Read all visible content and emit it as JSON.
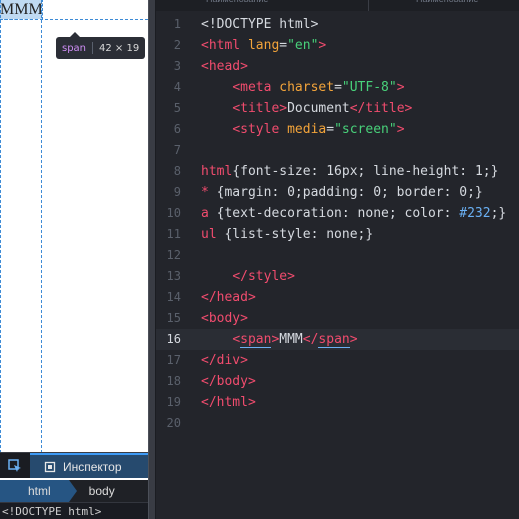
{
  "browser": {
    "rendered_text": "MMM",
    "tooltip": {
      "tag": "span",
      "dimensions": "42 × 19"
    }
  },
  "devtools": {
    "inspector_tab_label": "Инспектор",
    "breadcrumbs": [
      "html",
      "body"
    ],
    "markup_preview": "<!DOCTYPE html>"
  },
  "editor": {
    "tabs": [
      "Наименование",
      "Наименование"
    ],
    "active_line": 16,
    "lines": [
      {
        "n": "1",
        "tokens": [
          {
            "t": "<!DOCTYPE html>",
            "c": "text"
          }
        ]
      },
      {
        "n": "2",
        "tokens": [
          {
            "t": "<html",
            "c": "tag"
          },
          {
            "t": " lang",
            "c": "attr"
          },
          {
            "t": "=",
            "c": "punct"
          },
          {
            "t": "\"en\"",
            "c": "str"
          },
          {
            "t": ">",
            "c": "tag"
          }
        ]
      },
      {
        "n": "3",
        "tokens": [
          {
            "t": "<head>",
            "c": "tag"
          }
        ]
      },
      {
        "n": "4",
        "tokens": [
          {
            "t": "    ",
            "c": "text"
          },
          {
            "t": "<meta",
            "c": "tag"
          },
          {
            "t": " charset",
            "c": "attr"
          },
          {
            "t": "=",
            "c": "punct"
          },
          {
            "t": "\"UTF-8\"",
            "c": "str"
          },
          {
            "t": ">",
            "c": "tag"
          }
        ]
      },
      {
        "n": "5",
        "tokens": [
          {
            "t": "    ",
            "c": "text"
          },
          {
            "t": "<title>",
            "c": "tag"
          },
          {
            "t": "Document",
            "c": "text"
          },
          {
            "t": "</title>",
            "c": "tag"
          }
        ]
      },
      {
        "n": "6",
        "tokens": [
          {
            "t": "    ",
            "c": "text"
          },
          {
            "t": "<style",
            "c": "tag"
          },
          {
            "t": " media",
            "c": "attr"
          },
          {
            "t": "=",
            "c": "punct"
          },
          {
            "t": "\"screen\"",
            "c": "str"
          },
          {
            "t": ">",
            "c": "tag"
          }
        ]
      },
      {
        "n": "7",
        "tokens": []
      },
      {
        "n": "8",
        "tokens": [
          {
            "t": "html",
            "c": "sel"
          },
          {
            "t": "{font-size: 16px; line-height: 1;}",
            "c": "prop"
          }
        ]
      },
      {
        "n": "9",
        "tokens": [
          {
            "t": "*",
            "c": "sel"
          },
          {
            "t": " {margin: 0;padding: 0; border: 0;}",
            "c": "prop"
          }
        ]
      },
      {
        "n": "10",
        "tokens": [
          {
            "t": "a",
            "c": "sel"
          },
          {
            "t": " {text-decoration: none; color: ",
            "c": "prop"
          },
          {
            "t": "#232",
            "c": "hex"
          },
          {
            "t": ";}",
            "c": "prop"
          }
        ]
      },
      {
        "n": "11",
        "tokens": [
          {
            "t": "ul",
            "c": "sel"
          },
          {
            "t": " {list-style: none;}",
            "c": "prop"
          }
        ]
      },
      {
        "n": "12",
        "tokens": []
      },
      {
        "n": "13",
        "tokens": [
          {
            "t": "    ",
            "c": "text"
          },
          {
            "t": "</style>",
            "c": "tag"
          }
        ]
      },
      {
        "n": "14",
        "tokens": [
          {
            "t": "</head>",
            "c": "tag"
          }
        ]
      },
      {
        "n": "15",
        "tokens": [
          {
            "t": "<body>",
            "c": "tag"
          }
        ]
      },
      {
        "n": "16",
        "tokens": [
          {
            "t": "    ",
            "c": "text"
          },
          {
            "t": "<",
            "c": "tag"
          },
          {
            "t": "span",
            "c": "tag",
            "u": true
          },
          {
            "t": ">",
            "c": "tag"
          },
          {
            "t": "MMM",
            "c": "text"
          },
          {
            "t": "</",
            "c": "tag"
          },
          {
            "t": "span",
            "c": "tag",
            "u": true
          },
          {
            "t": ">",
            "c": "tag"
          }
        ]
      },
      {
        "n": "17",
        "tokens": [
          {
            "t": "</div>",
            "c": "tag"
          }
        ]
      },
      {
        "n": "18",
        "tokens": [
          {
            "t": "</body>",
            "c": "tag"
          }
        ]
      },
      {
        "n": "19",
        "tokens": [
          {
            "t": "</html>",
            "c": "tag"
          }
        ]
      },
      {
        "n": "20",
        "tokens": []
      }
    ]
  }
}
